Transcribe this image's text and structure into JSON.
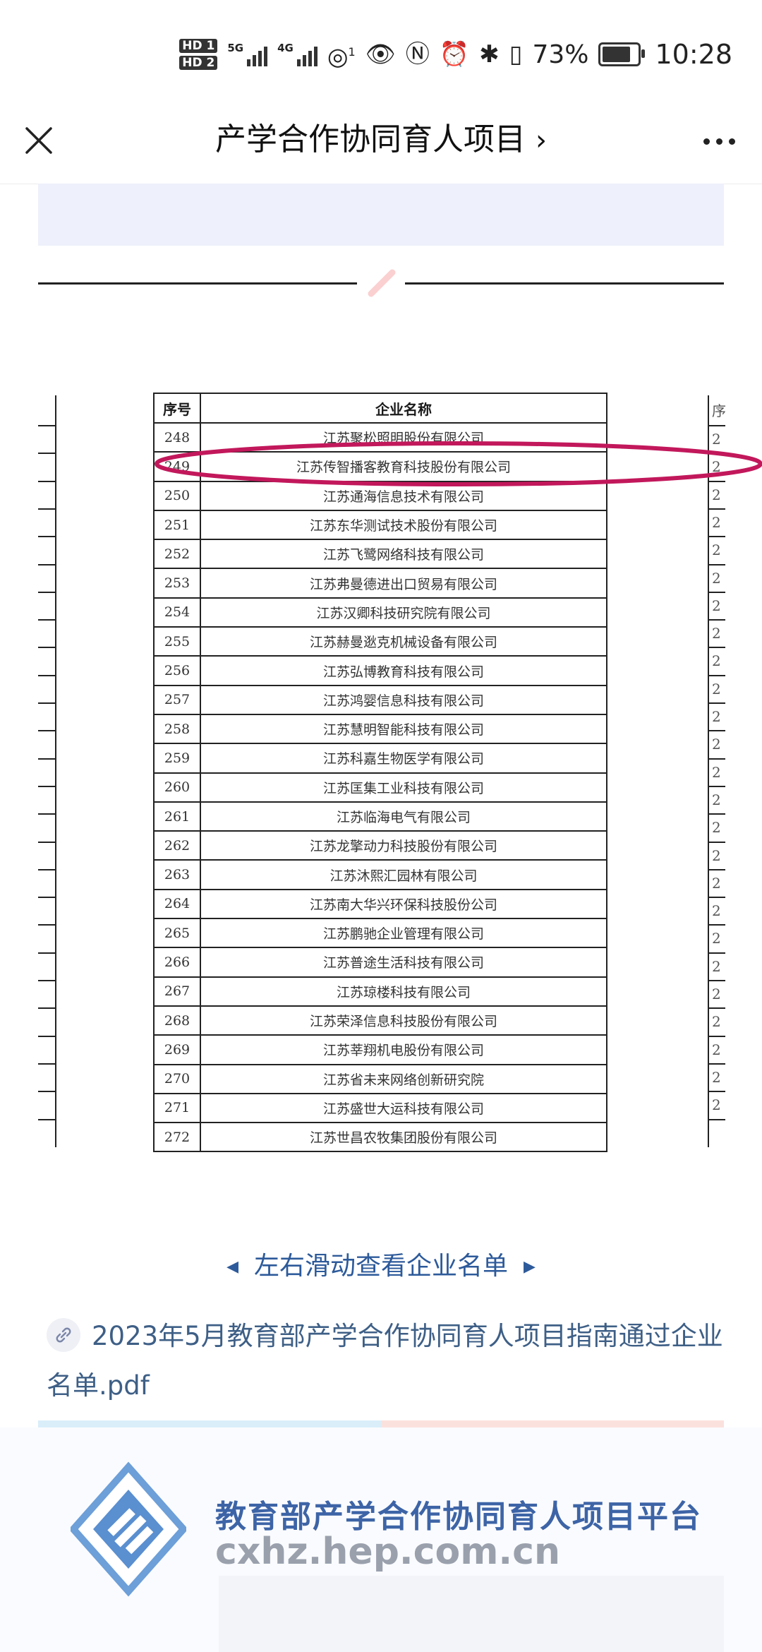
{
  "status_bar": {
    "hd1": "HD 1",
    "hd2": "HD 2",
    "net1": "5G",
    "net2": "4G",
    "hotspot_sup": "1",
    "battery": "73%",
    "time": "10:28"
  },
  "titlebar": {
    "title": "产学合作协同育人项目",
    "chevron": "›"
  },
  "table": {
    "headers": [
      "序号",
      "企业名称"
    ],
    "right_partial_header": "序",
    "rows": [
      [
        "248",
        "江苏聚松照明股份有限公司"
      ],
      [
        "249",
        "江苏传智播客教育科技股份有限公司"
      ],
      [
        "250",
        "江苏通海信息技术有限公司"
      ],
      [
        "251",
        "江苏东华测试技术股份有限公司"
      ],
      [
        "252",
        "江苏飞鹭网络科技有限公司"
      ],
      [
        "253",
        "江苏弗曼德进出口贸易有限公司"
      ],
      [
        "254",
        "江苏汉卿科技研究院有限公司"
      ],
      [
        "255",
        "江苏赫曼逖克机械设备有限公司"
      ],
      [
        "256",
        "江苏弘博教育科技有限公司"
      ],
      [
        "257",
        "江苏鸿婴信息科技有限公司"
      ],
      [
        "258",
        "江苏慧明智能科技有限公司"
      ],
      [
        "259",
        "江苏科嘉生物医学有限公司"
      ],
      [
        "260",
        "江苏匡集工业科技有限公司"
      ],
      [
        "261",
        "江苏临海电气有限公司"
      ],
      [
        "262",
        "江苏龙擎动力科技股份有限公司"
      ],
      [
        "263",
        "江苏沐熙汇园林有限公司"
      ],
      [
        "264",
        "江苏南大华兴环保科技股份公司"
      ],
      [
        "265",
        "江苏鹏驰企业管理有限公司"
      ],
      [
        "266",
        "江苏普途生活科技有限公司"
      ],
      [
        "267",
        "江苏琼楼科技有限公司"
      ],
      [
        "268",
        "江苏荣泽信息科技股份有限公司"
      ],
      [
        "269",
        "江苏莘翔机电股份有限公司"
      ],
      [
        "270",
        "江苏省未来网络创新研究院"
      ],
      [
        "271",
        "江苏盛世大运科技有限公司"
      ],
      [
        "272",
        "江苏世昌农牧集团股份有限公司"
      ]
    ],
    "right_partial_digit": "2",
    "highlight_color": "#c2185b"
  },
  "swipe_hint": "左右滑动查看企业名单",
  "attachment": {
    "filename": "2023年5月教育部产学合作协同育人项目指南通过企业名单.pdf"
  },
  "footer": {
    "platform_title": "教育部产学合作协同育人项目平台",
    "platform_url": "cxhz.hep.com.cn",
    "brand_color": "#3d64a6"
  }
}
